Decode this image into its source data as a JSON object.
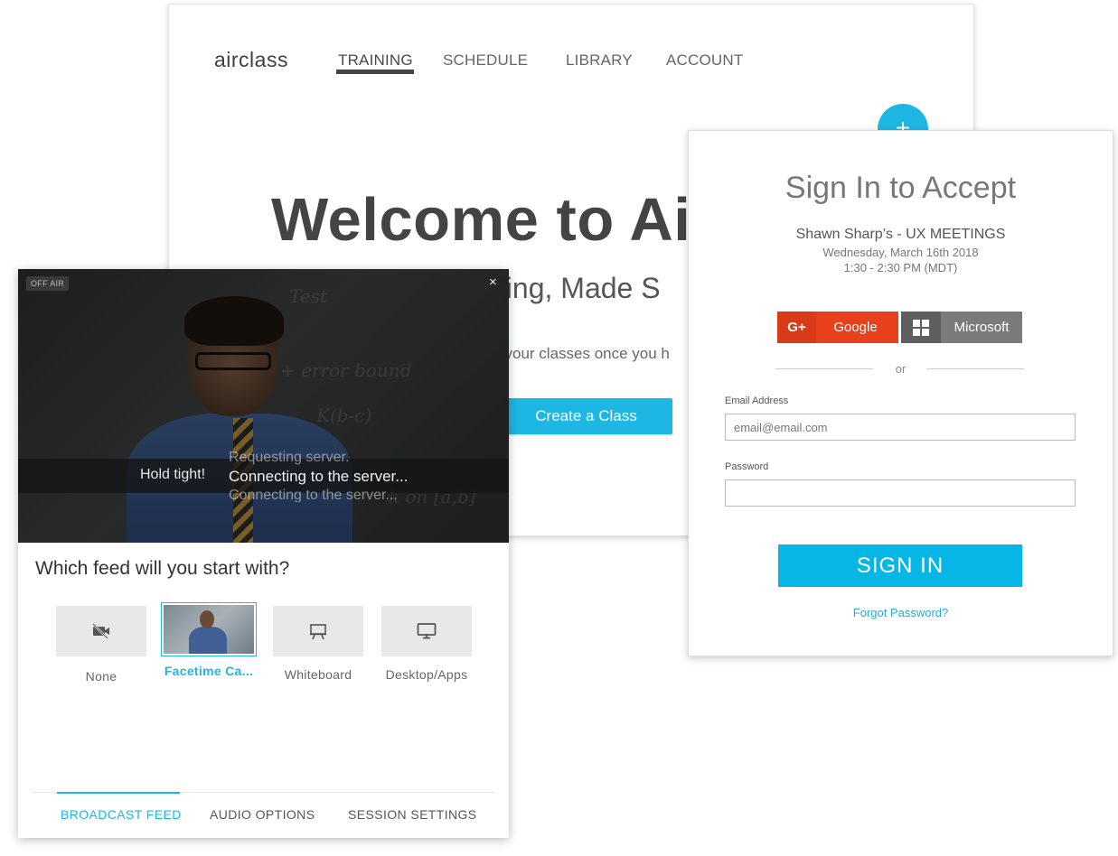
{
  "main": {
    "logo": "airclass",
    "nav": [
      {
        "label": "TRAINING"
      },
      {
        "label": "SCHEDULE"
      },
      {
        "label": "LIBRARY"
      },
      {
        "label": "ACCOUNT"
      }
    ],
    "add_symbol": "+",
    "welcome": "Welcome to Ai",
    "tagline": "ning, Made S",
    "subtext": "l your classes once you h",
    "create_button": "Create a Class"
  },
  "broadcast": {
    "status_badge": "OFF AIR",
    "close_symbol": "×",
    "hold": "Hold tight!",
    "status_previous": "Requesting server.",
    "status_current": "Connecting to the server...",
    "status_next": "Connecting to the server...",
    "question": "Which feed will you start with?",
    "feeds": [
      {
        "label": "None",
        "icon": "camera-off-icon"
      },
      {
        "label": "Facetime Ca...",
        "icon": "camera-thumbnail"
      },
      {
        "label": "Whiteboard",
        "icon": "whiteboard-icon"
      },
      {
        "label": "Desktop/Apps",
        "icon": "monitor-icon"
      }
    ],
    "tabs": [
      {
        "label": "BROADCAST FEED"
      },
      {
        "label": "AUDIO OPTIONS"
      },
      {
        "label": "SESSION SETTINGS"
      }
    ]
  },
  "signin": {
    "title": "Sign In to Accept",
    "meeting_name": "Shawn Sharp’s - UX MEETINGS",
    "meeting_date": "Wednesday, March 16th 2018",
    "meeting_time": "1:30 - 2:30 PM (MDT)",
    "google_icon": "G+",
    "google_label": "Google",
    "microsoft_label": "Microsoft",
    "or": "or",
    "email_label": "Email Address",
    "email_placeholder": "email@email.com",
    "password_label": "Password",
    "password_placeholder": "",
    "sign_in_button": "SIGN IN",
    "forgot": "Forgot Password?"
  },
  "colors": {
    "accent": "#1eb6e2",
    "google": "#e8401d",
    "microsoft": "#7b7b7b"
  }
}
